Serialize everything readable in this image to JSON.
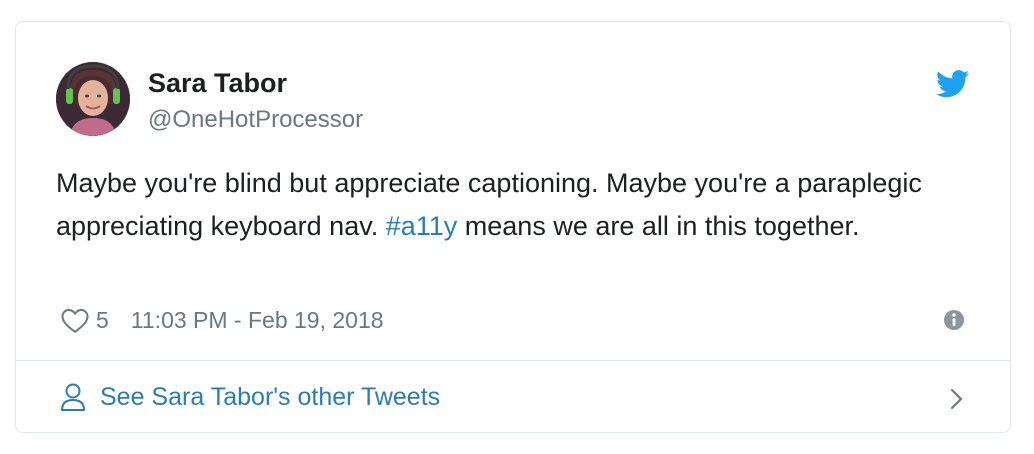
{
  "tweet": {
    "author_name": "Sara Tabor",
    "author_handle": "@OneHotProcessor",
    "text_before": "Maybe you're blind but appreciate captioning. Maybe you're a paraplegic appreciating keyboard nav. ",
    "hashtag": "#a11y",
    "text_after": " means we are all in this together.",
    "likes": "5",
    "timestamp": "11:03 PM - Feb 19, 2018",
    "footer_link": "See Sara Tabor's other Tweets"
  },
  "icons": {
    "brand": "twitter-bird-icon",
    "like": "heart-icon",
    "info": "info-icon",
    "profile": "person-icon",
    "chevron": "chevron-right-icon"
  },
  "colors": {
    "link": "#2b7bb9",
    "twitter_blue": "#1da1f2",
    "muted": "#697882",
    "border": "#e1e8ed"
  }
}
